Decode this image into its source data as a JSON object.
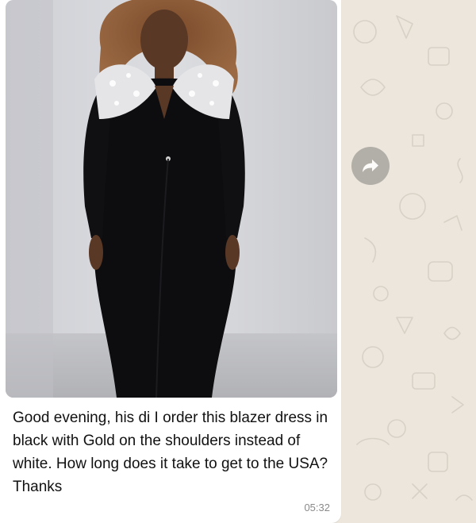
{
  "message": {
    "text": "Good evening, his di I order this blazer dress in black with Gold on the shoulders instead of white. How long does it take to get to the USA? Thanks",
    "time": "05:32",
    "media_description": "photo"
  },
  "actions": {
    "forward_icon": "forward-icon"
  },
  "colors": {
    "wallpaper": "#ece6dd",
    "bubble": "#ffffff",
    "text": "#111111",
    "timestamp": "#8a8a8a",
    "forward_button": "#a9a59f"
  }
}
